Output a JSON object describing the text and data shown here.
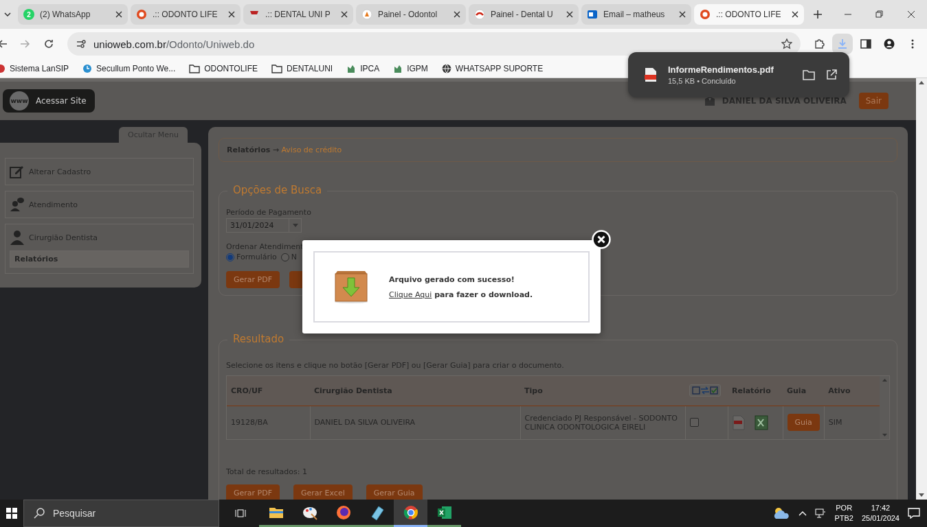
{
  "browser": {
    "tabs": [
      {
        "title": "(2) WhatsApp",
        "badge": "2",
        "selected": false
      },
      {
        "title": ".:: ODONTO LIFE",
        "selected": false
      },
      {
        "title": ".:: DENTAL UNI P",
        "selected": false
      },
      {
        "title": "Painel - Odontol",
        "selected": false
      },
      {
        "title": "Painel - Dental U",
        "selected": false
      },
      {
        "title": "Email – matheus",
        "selected": false
      },
      {
        "title": ".:: ODONTO LIFE",
        "selected": true
      }
    ],
    "address": {
      "domain": "unioweb.com.br",
      "path": "/Odonto/Uniweb.do"
    },
    "bookmarks": [
      {
        "label": "Sistema LanSIP",
        "kind": "site"
      },
      {
        "label": "Secullum Ponto We...",
        "kind": "site"
      },
      {
        "label": "ODONTOLIFE",
        "kind": "folder"
      },
      {
        "label": "DENTALUNI",
        "kind": "folder"
      },
      {
        "label": "IPCA",
        "kind": "site"
      },
      {
        "label": "IGPM",
        "kind": "site"
      },
      {
        "label": "WHATSAPP SUPORTE",
        "kind": "globe"
      }
    ],
    "download": {
      "filename": "InformeRendimentos.pdf",
      "details": "15,5 KB • Concluído"
    }
  },
  "header": {
    "site_icon_text": "www",
    "site_button": "Acessar Site",
    "user_name": "DANIEL DA SILVA OLIVEIRA",
    "logout_button": "Sair"
  },
  "sidebar": {
    "toggle": "Ocultar Menu",
    "items": [
      {
        "label": "Alterar Cadastro"
      },
      {
        "label": "Atendimento"
      },
      {
        "label": "Cirurgião Dentista",
        "children": [
          {
            "label": "Relatórios",
            "selected": true
          }
        ]
      }
    ]
  },
  "breadcrumb": {
    "section": "Relatórios",
    "separator": "→",
    "page": "Aviso de crédito"
  },
  "search": {
    "title": "Opções de Busca",
    "period_label": "Período de Pagamento",
    "period_value": "31/01/2024",
    "order_label": "Ordenar Atendiment",
    "order_options": [
      {
        "label": "Formulário",
        "selected": true
      },
      {
        "label": "N",
        "selected": false
      }
    ],
    "buttons": [
      "Gerar PDF"
    ]
  },
  "results": {
    "title": "Resultado",
    "instructions": "Selecione os itens e clique no botão [Gerar PDF] ou [Gerar Guia] para criar o documento.",
    "columns": [
      {
        "kind": "text",
        "label": "CRO/UF"
      },
      {
        "kind": "text",
        "label": "Cirurgião Dentista"
      },
      {
        "kind": "text",
        "label": "Tipo"
      },
      {
        "kind": "toggle"
      },
      {
        "kind": "text",
        "label": "Relatório"
      },
      {
        "kind": "text",
        "label": "Guia"
      },
      {
        "kind": "text",
        "label": "Ativo"
      }
    ],
    "rows": [
      {
        "cro": "19128/BA",
        "dentist": "DANIEL DA SILVA OLIVEIRA",
        "type": "Credenciado PJ Responsável - SODONTO CLINICA ODONTOLOGICA EIRELI",
        "checked": false,
        "guide_button": "Guia",
        "active": "SIM"
      }
    ],
    "total": "Total de resultados: 1",
    "buttons": [
      "Gerar PDF",
      "Gerar Excel",
      "Gerar Guia"
    ]
  },
  "dialog": {
    "title": "Arquivo gerado com sucesso!",
    "link": "Clique Aqui",
    "message": " para fazer o download."
  },
  "taskbar": {
    "search_placeholder": "Pesquisar",
    "apps": [
      {
        "selected": false
      },
      {
        "selected": false
      },
      {
        "selected": false
      },
      {
        "selected": false
      },
      {
        "selected": true
      },
      {
        "selected": false
      }
    ],
    "language": "POR",
    "layout": "PTB2",
    "time": "17:42",
    "date": "25/01/2024"
  }
}
